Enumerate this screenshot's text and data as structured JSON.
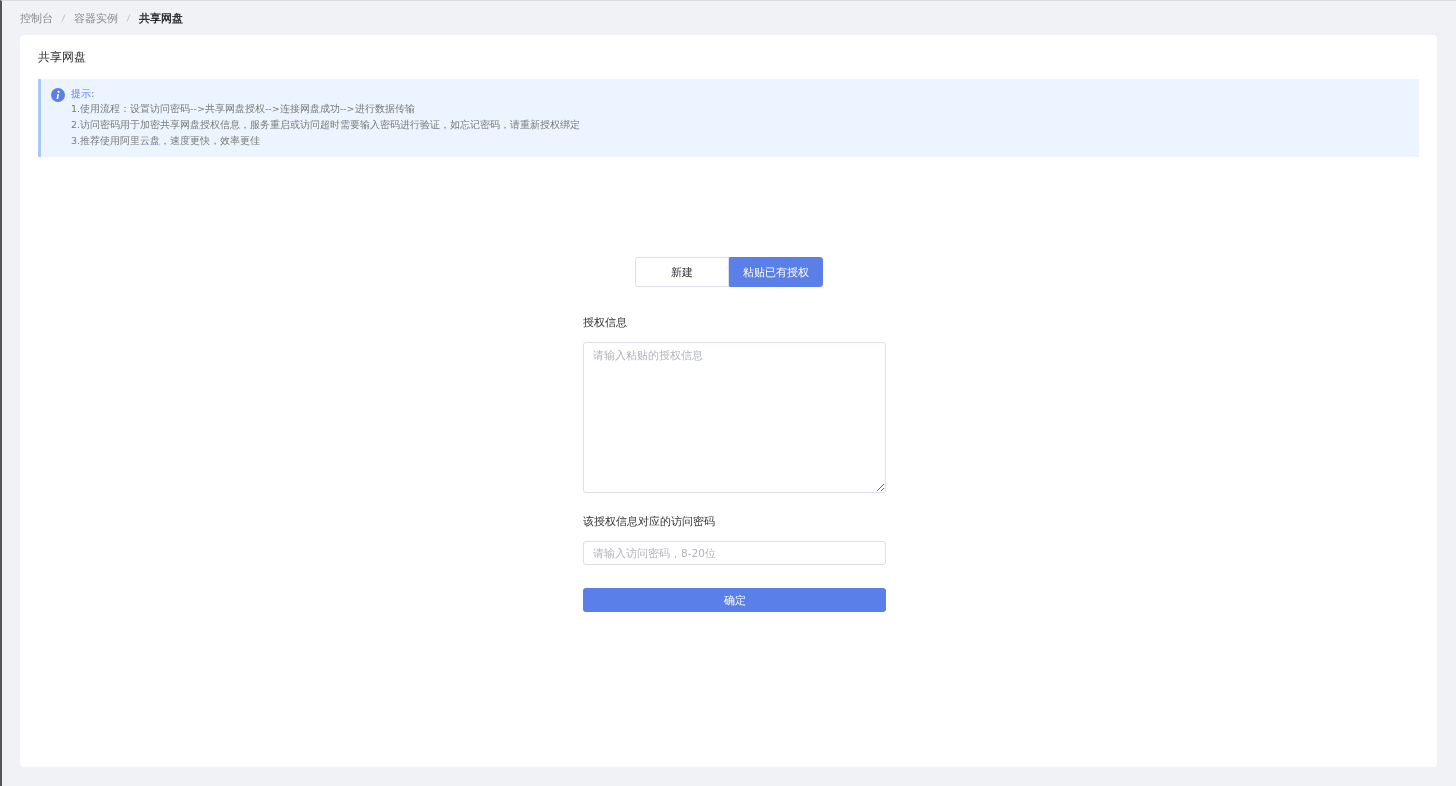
{
  "breadcrumb": [
    {
      "label": "控制台",
      "current": false
    },
    {
      "label": "容器实例",
      "current": false
    },
    {
      "label": "共享网盘",
      "current": true
    }
  ],
  "card": {
    "title": "共享网盘"
  },
  "notice": {
    "title": "提示:",
    "lines": [
      "1.使用流程：设置访问密码-->共享网盘授权-->连接网盘成功-->进行数据传输",
      "2.访问密码用于加密共享网盘授权信息，服务重启或访问超时需要输入密码进行验证，如忘记密码，请重新授权绑定",
      "3.推荐使用阿里云盘，速度更快，效率更佳"
    ]
  },
  "tabs": [
    {
      "label": "新建",
      "selected": false
    },
    {
      "label": "粘贴已有授权",
      "selected": true
    }
  ],
  "form": {
    "fields": [
      {
        "kind": "textarea",
        "label": "授权信息",
        "placeholder": "请输入粘贴的授权信息"
      },
      {
        "kind": "input",
        "label": "该授权信息对应的访问密码",
        "placeholder": "请输入访问密码，8-20位"
      }
    ],
    "submit": "确定"
  }
}
